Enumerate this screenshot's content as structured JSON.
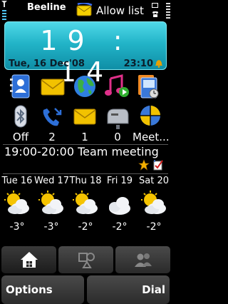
{
  "status": {
    "operator": "Beeline",
    "profile_text": "Allow list"
  },
  "clock": {
    "time": "19 : 14",
    "date": "Tue, 16 Dec'08",
    "alarm": "23:10"
  },
  "shortcuts": [
    {
      "icon": "contacts-icon"
    },
    {
      "icon": "messaging-icon"
    },
    {
      "icon": "web-globe-icon"
    },
    {
      "icon": "music-player-icon"
    },
    {
      "icon": "gallery-icon"
    }
  ],
  "notifications": [
    {
      "icon": "bluetooth-icon",
      "label": "Off"
    },
    {
      "icon": "missed-calls-icon",
      "label": "2"
    },
    {
      "icon": "new-messages-icon",
      "label": "1"
    },
    {
      "icon": "mailbox-icon",
      "label": "0"
    },
    {
      "icon": "meeting-icon",
      "label": "Meet..."
    }
  ],
  "calendar": {
    "entry": "19:00-20:00 Team meeting"
  },
  "weather": [
    {
      "day": "Tue 16",
      "temp": "-3°"
    },
    {
      "day": "Wed 17",
      "temp": "-3°"
    },
    {
      "day": "Thu 18",
      "temp": "-2°"
    },
    {
      "day": "Fri 19",
      "temp": "-2°"
    },
    {
      "day": "Sat 20",
      "temp": "-2°"
    }
  ],
  "tabs": [
    {
      "icon": "home-icon",
      "active": true
    },
    {
      "icon": "shapes-icon",
      "active": false
    },
    {
      "icon": "people-icon",
      "active": false
    }
  ],
  "softkeys": {
    "left": "Options",
    "right": "Dial"
  },
  "colors": {
    "clock_panel": "#22b4c8",
    "background": "#000000"
  }
}
